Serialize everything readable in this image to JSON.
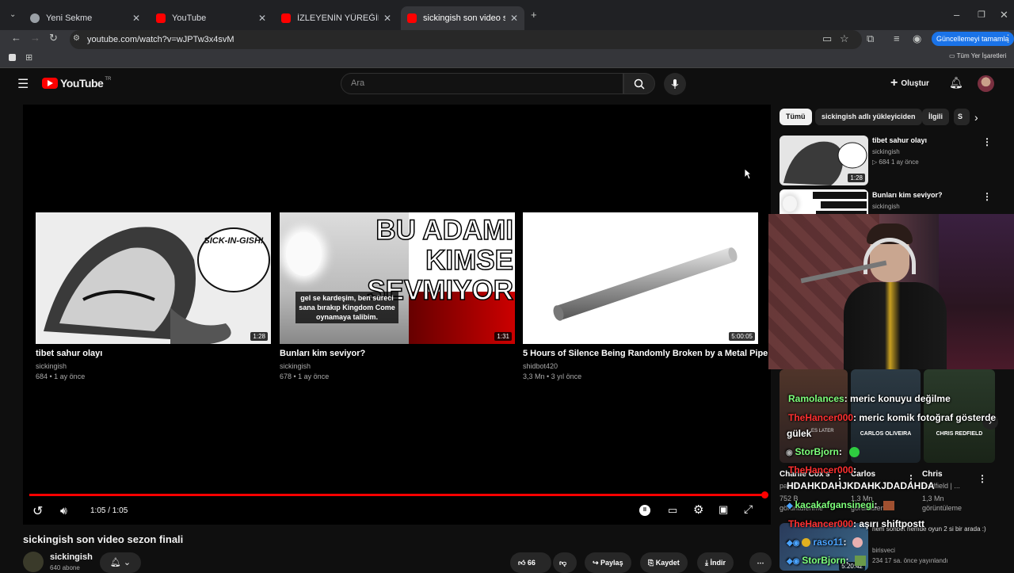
{
  "browser": {
    "tabs": [
      {
        "label": "Yeni Sekme",
        "active": false
      },
      {
        "label": "YouTube",
        "active": false
      },
      {
        "label": "İZLEYENİN YÜREĞİNİ HOPLATA",
        "active": false
      },
      {
        "label": "sickingish son video sezon finali",
        "active": true
      }
    ],
    "url": "youtube.com/watch?v=wJPTw3x4svM",
    "update_button": "Güncellemeyi tamamla",
    "bookmarks_all": "Tüm Yer İşaretleri"
  },
  "youtube": {
    "logo_text": "YouTube",
    "region": "TR",
    "search_placeholder": "Ara",
    "create_label": "Oluştur",
    "chips": [
      "Tümü",
      "sickingish adlı yükleyiciden",
      "İlgili",
      "S"
    ],
    "player": {
      "time": "1:05 / 1:05",
      "progress": 1.0,
      "endcards": [
        {
          "title": "tibet sahur olayı",
          "channel": "sickingish",
          "meta": "684 • 1 ay önce",
          "duration": "1:28",
          "overlay_text": "SICK-IN-GISH!"
        },
        {
          "title": "Bunları kim seviyor?",
          "channel": "sickingish",
          "meta": "678 • 1 ay önce",
          "duration": "1:31",
          "overlay_big": "BU ADAMI KIMSE SEVMIYOR",
          "caption": "gel se kardeşim, ben süreci sana bırakıp Kingdom Come oynamaya talibim."
        },
        {
          "title": "5 Hours of Silence Being Randomly Broken by a Metal Pipe",
          "channel": "shidbot420",
          "meta": "3,3 Mn • 3 yıl önce",
          "duration": "5:00:05"
        }
      ]
    },
    "video": {
      "title": "sickingish son video sezon finali",
      "channel": "sickingish",
      "subs": "640 abone",
      "likes": "66",
      "share": "Paylaş",
      "save": "Kaydet",
      "download": "İndir"
    },
    "sidebar": [
      {
        "title": "tibet sahur olayı",
        "channel": "sickingish",
        "meta": "684   1 ay önce",
        "duration": "1:28"
      },
      {
        "title": "Bunları kim seviyor?",
        "channel": "sickingish"
      }
    ],
    "lower": [
      {
        "title": "Charlie Cox's",
        "meta1": "patlattı",
        "meta2": "752 B",
        "meta3": "görüntülenme"
      },
      {
        "title": "Carlos",
        "meta1": "Oliveira",
        "meta2": "1,3 Mn",
        "meta3": "görüntüleme"
      },
      {
        "title": "Chris",
        "meta1": "Redfield | ...",
        "meta2": "1,3 Mn",
        "meta3": "görüntüleme"
      }
    ],
    "lower_bottom": {
      "title": "hem sohbet hemde oyun 2 si bir arada :)",
      "channel": "birisveci",
      "meta": "234   17 sa. önce yayınlandı",
      "duration": "5:20:42"
    },
    "thumb_labels": [
      "CARLOS OLIVEIRA",
      "CHRIS REDFIELD",
      "ES LATER"
    ]
  },
  "chat": [
    {
      "user": "Ramolances",
      "msg": ": meric konuyu değilme",
      "color": "#7dff7a"
    },
    {
      "user": "TheHancer000",
      "msg": ": meric komik fotoğraf gösterde",
      "color": "#ff3030"
    },
    {
      "user": "",
      "msg": "gülek",
      "color": "#ffffff"
    },
    {
      "user": "StorBjorn",
      "msg": ":",
      "color": "#7dff7a"
    },
    {
      "user": "TheHancer000",
      "msg": ":",
      "color": "#ff3030"
    },
    {
      "user": "",
      "msg": "HDAHKDAHJKDAHKJDADAHDA",
      "color": "#ffffff"
    },
    {
      "user": "kacakafgansinegi",
      "msg": ":",
      "color": "#7dff7a"
    },
    {
      "user": "TheHancer000",
      "msg": ": aşırı shiftpostt",
      "color": "#ff3030"
    },
    {
      "user": "raso11",
      "msg": ":",
      "color": "#4aa3ff"
    },
    {
      "user": "StorBjorn",
      "msg": ":",
      "color": "#7dff7a"
    }
  ]
}
